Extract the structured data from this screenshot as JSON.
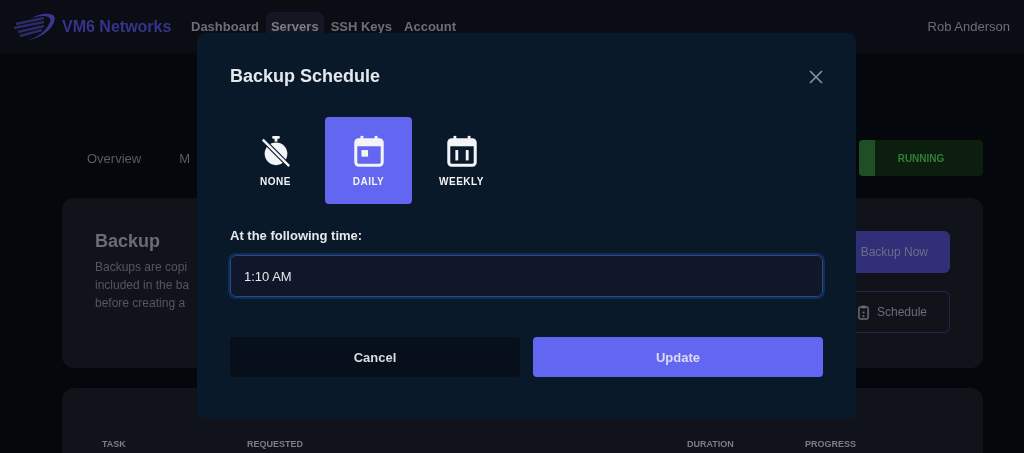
{
  "header": {
    "brand": "VM6 Networks",
    "nav": [
      {
        "label": "Dashboard",
        "selected": false
      },
      {
        "label": "Servers",
        "selected": true
      },
      {
        "label": "SSH Keys",
        "selected": false
      },
      {
        "label": "Account",
        "selected": false
      }
    ],
    "user": "Rob Anderson"
  },
  "tabs": [
    {
      "label": "Overview"
    },
    {
      "label": "M"
    }
  ],
  "status": "RUNNING",
  "backup_card": {
    "title": "Backup",
    "description_lines": [
      "Backups are copi",
      "included in the ba",
      "before creating a"
    ],
    "buttons": [
      {
        "label": "Backup Now",
        "kind": "primary"
      },
      {
        "label": "Schedule",
        "kind": "outline"
      }
    ]
  },
  "table": {
    "columns": [
      "TASK",
      "REQUESTED",
      "DURATION",
      "PROGRESS"
    ]
  },
  "modal": {
    "title": "Backup Schedule",
    "options": [
      {
        "label": "NONE",
        "kind": "none",
        "selected": false
      },
      {
        "label": "DAILY",
        "kind": "daily",
        "selected": true
      },
      {
        "label": "WEEKLY",
        "kind": "weekly",
        "selected": false
      }
    ],
    "time_label": "At the following time:",
    "time_value": "1:10 AM",
    "buttons": [
      {
        "label": "Cancel",
        "kind": "secondary"
      },
      {
        "label": "Update",
        "kind": "primary"
      }
    ]
  }
}
